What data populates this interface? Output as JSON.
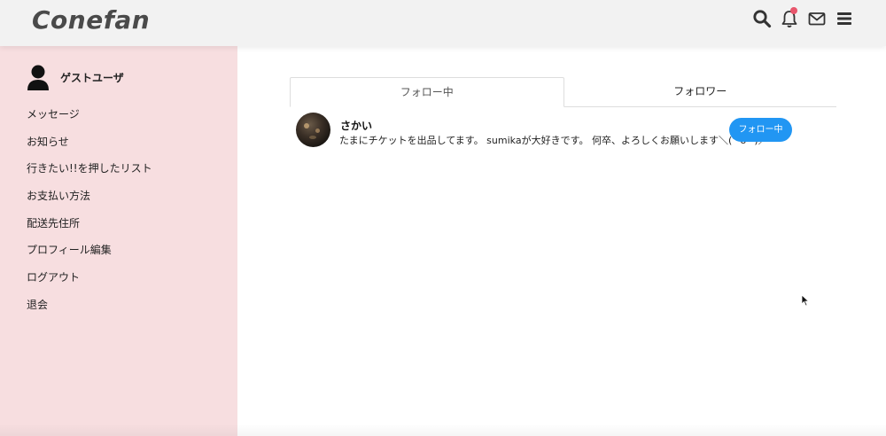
{
  "app": {
    "logo": "Conefan",
    "accent_color": "#2196f3",
    "notification_dot_color": "#e8566c"
  },
  "header": {
    "icons": [
      "search-icon",
      "bell-icon",
      "mail-icon",
      "hamburger-menu-icon"
    ],
    "has_notification": true
  },
  "sidebar": {
    "user_name": "ゲストユーザ",
    "items": [
      {
        "label": "メッセージ"
      },
      {
        "label": "お知らせ"
      },
      {
        "label": "行きたい!!を押したリスト"
      },
      {
        "label": "お支払い方法"
      },
      {
        "label": "配送先住所"
      },
      {
        "label": "プロフィール編集"
      },
      {
        "label": "ログアウト"
      },
      {
        "label": "退会"
      }
    ]
  },
  "main": {
    "tabs": [
      {
        "label": "フォロー中",
        "active": true
      },
      {
        "label": "フォロワー",
        "active": false
      }
    ],
    "users": [
      {
        "name": "さかい",
        "bio": "たまにチケットを出品してます。 sumikaが大好きです。 何卒、よろしくお願いします＼(^o^)／",
        "button_label": "フォロー中"
      }
    ]
  }
}
